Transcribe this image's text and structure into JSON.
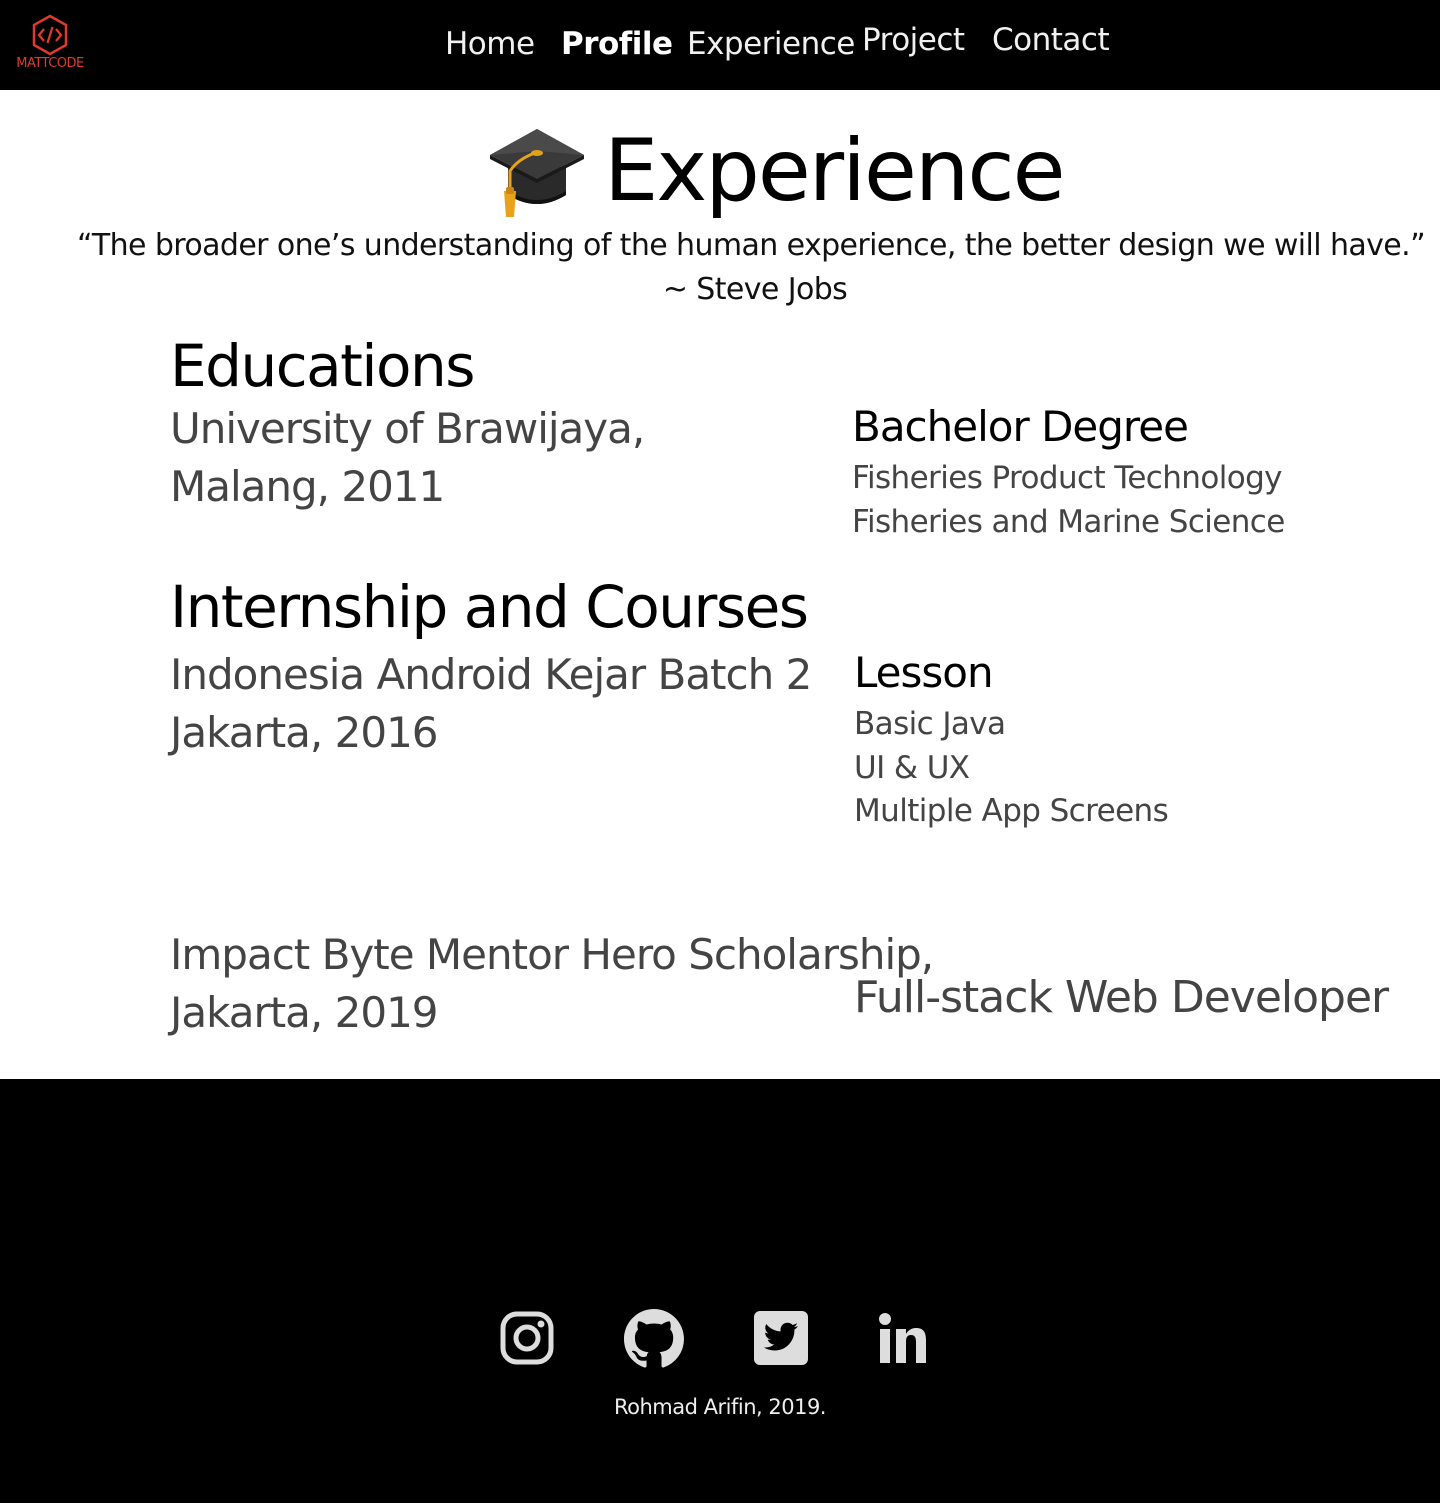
{
  "brand": {
    "logo_text": "MATTCODE",
    "accent_color": "#e03a2b",
    "icon": "code-hexagon-icon"
  },
  "nav": {
    "items": [
      {
        "label": "Home"
      },
      {
        "label": "Profile",
        "active": true
      },
      {
        "label": "Experience"
      },
      {
        "label": "Project"
      },
      {
        "label": "Contact"
      }
    ]
  },
  "hero": {
    "icon": "graduation-cap-icon",
    "title": "Experience",
    "quote": "“The broader one’s understanding of the human experience, the better design we will have.”",
    "author": "~ Steve Jobs"
  },
  "educations": {
    "heading": "Educations",
    "place_line1": "University of Brawijaya,",
    "place_line2": "Malang, 2011",
    "degree_title": "Bachelor Degree",
    "degree_line1": "Fisheries Product Technology",
    "degree_line2": "Fisheries and Marine Science"
  },
  "internship": {
    "heading": "Internship and Courses",
    "course1": {
      "line1": "Indonesia Android Kejar Batch 2",
      "line2": "Jakarta, 2016",
      "detail_title": "Lesson",
      "lessons": [
        "Basic Java",
        "UI & UX",
        "Multiple App Screens"
      ]
    },
    "course2": {
      "line1": "Impact Byte Mentor Hero Scholarship,",
      "line2": "Jakarta, 2019",
      "role": "Full-stack Web Developer"
    }
  },
  "footer": {
    "social": [
      {
        "icon": "instagram-icon"
      },
      {
        "icon": "github-icon"
      },
      {
        "icon": "twitter-icon"
      },
      {
        "icon": "linkedin-icon"
      }
    ],
    "copyright": "Rohmad Arifin, 2019."
  }
}
